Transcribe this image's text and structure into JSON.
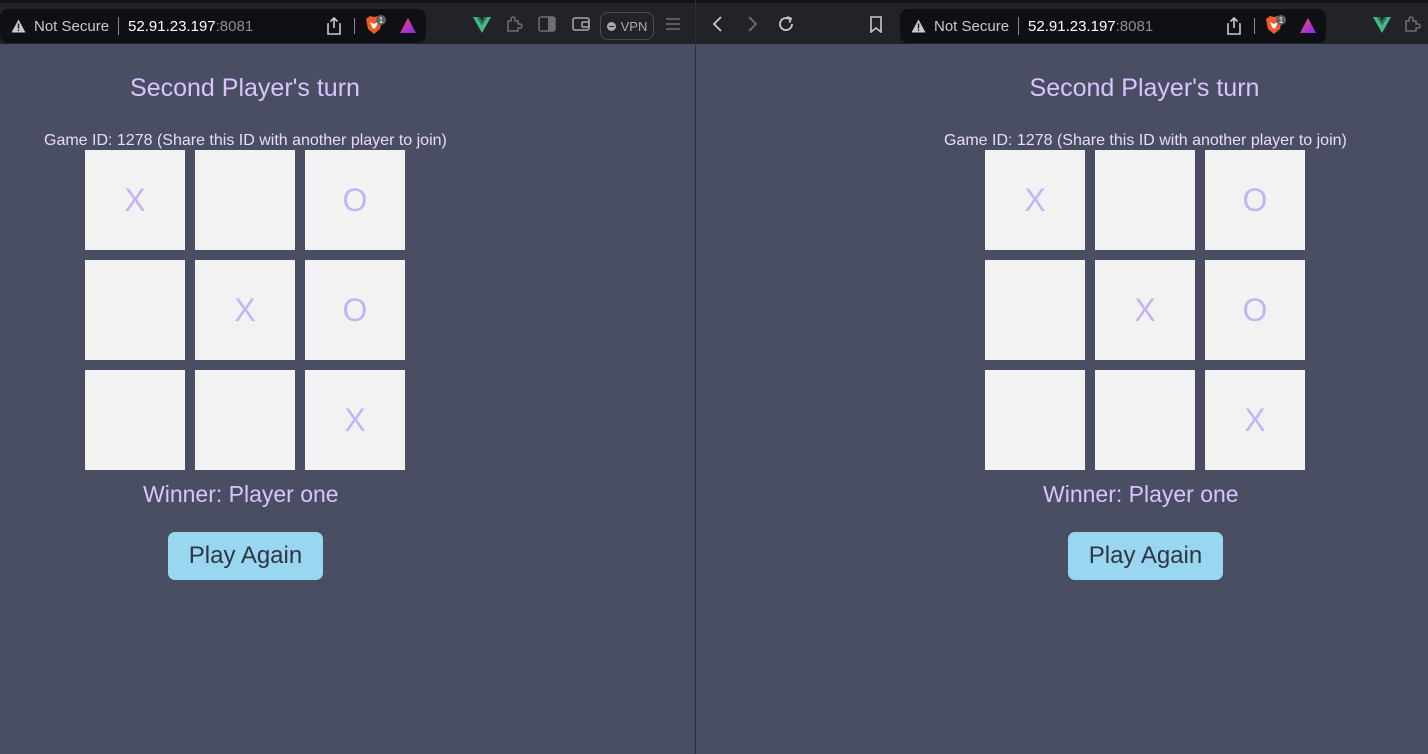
{
  "windows": [
    {
      "address_bar": {
        "security_label": "Not Secure",
        "host": "52.91.23.197",
        "port": ":8081",
        "brave_badge": "1"
      },
      "vpn_label": "VPN",
      "game": {
        "turn_text": "Second Player's turn",
        "game_id_text": "Game ID: 1278 (Share this ID with another player to join)",
        "board": [
          [
            "X",
            "",
            "O"
          ],
          [
            "",
            "X",
            "O"
          ],
          [
            "",
            "",
            "X"
          ]
        ],
        "winner_text": "Winner: Player one",
        "play_again_label": "Play Again"
      }
    },
    {
      "address_bar": {
        "security_label": "Not Secure",
        "host": "52.91.23.197",
        "port": ":8081",
        "brave_badge": "1"
      },
      "game": {
        "turn_text": "Second Player's turn",
        "game_id_text": "Game ID: 1278 (Share this ID with another player to join)",
        "board": [
          [
            "X",
            "",
            "O"
          ],
          [
            "",
            "X",
            "O"
          ],
          [
            "",
            "",
            "X"
          ]
        ],
        "winner_text": "Winner: Player one",
        "play_again_label": "Play Again"
      }
    }
  ],
  "colors": {
    "background": "#4a4e62",
    "title": "#d9c4ff",
    "cell": "#f2f2f2",
    "mark": "#c6b3f2",
    "button": "#99d6f0",
    "vue_green": "#42b883"
  },
  "icons": [
    "warning-icon",
    "share-icon",
    "brave-shield-icon",
    "triangle-rewards-icon",
    "vue-devtools-icon",
    "extensions-icon",
    "sidebar-icon",
    "wallet-icon",
    "menu-icon",
    "back-icon",
    "forward-icon",
    "reload-icon",
    "bookmark-icon"
  ]
}
